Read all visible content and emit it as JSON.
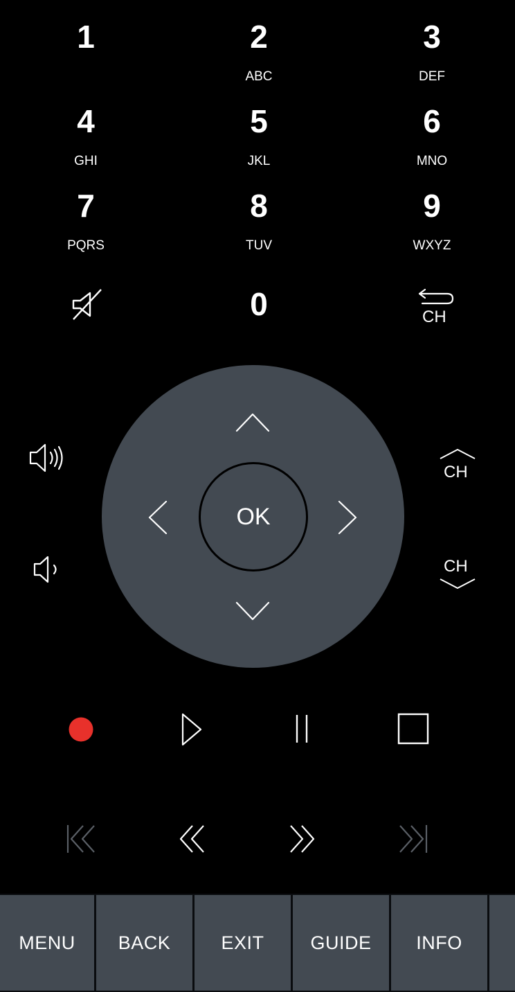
{
  "keypad": [
    {
      "digit": "1",
      "letters": ""
    },
    {
      "digit": "2",
      "letters": "ABC"
    },
    {
      "digit": "3",
      "letters": "DEF"
    },
    {
      "digit": "4",
      "letters": "GHI"
    },
    {
      "digit": "5",
      "letters": "JKL"
    },
    {
      "digit": "6",
      "letters": "MNO"
    },
    {
      "digit": "7",
      "letters": "PQRS"
    },
    {
      "digit": "8",
      "letters": "TUV"
    },
    {
      "digit": "9",
      "letters": "WXYZ"
    },
    {
      "digit": "0",
      "letters": ""
    }
  ],
  "channel": {
    "return_label": "CH",
    "up_label": "CH",
    "down_label": "CH"
  },
  "dpad": {
    "ok_label": "OK"
  },
  "icons": {
    "mute": "mute-icon",
    "volume_up": "volume-up-icon",
    "volume_down": "volume-down-icon",
    "record": "record-icon",
    "play": "play-icon",
    "pause": "pause-icon",
    "stop": "stop-icon",
    "skip_back": "skip-back-icon",
    "rewind": "rewind-icon",
    "fast_forward": "fast-forward-icon",
    "skip_forward": "skip-forward-icon"
  },
  "colors": {
    "background": "#000000",
    "dpad": "#434a52",
    "tab": "#434a52",
    "record": "#e8312b",
    "disabled": "#5a5f66"
  },
  "bottom_tabs": [
    "MENU",
    "BACK",
    "EXIT",
    "GUIDE",
    "INFO",
    ""
  ]
}
